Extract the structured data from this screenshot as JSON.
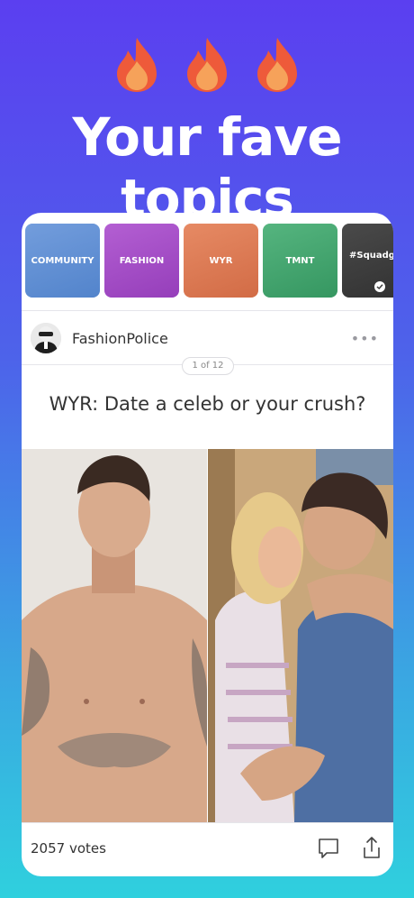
{
  "headline": "Your fave topics",
  "icons": {
    "flame": "flame-icon",
    "comment": "comment-icon",
    "share": "share-icon",
    "check": "check-icon",
    "more": "more-icon"
  },
  "topics": [
    {
      "label": "COMMUNITY",
      "color": "#5d8fd6"
    },
    {
      "label": "FASHION",
      "color": "#a447c8"
    },
    {
      "label": "WYR",
      "color": "#e07a52"
    },
    {
      "label": "TMNT",
      "color": "#3fa66d"
    },
    {
      "label": "#Squadgoals",
      "color": "#3b3b3b",
      "selected": true
    }
  ],
  "post": {
    "username": "FashionPolice",
    "more_label": "•••",
    "pager": "1 of 12",
    "question": "WYR: Date a celeb or your crush?",
    "votes": "2057 votes"
  },
  "colors": {
    "background_top": "#5b3ff0",
    "background_bottom": "#2fd0de",
    "flame_outer": "#ee5a3a",
    "flame_inner": "#f6a25a"
  }
}
